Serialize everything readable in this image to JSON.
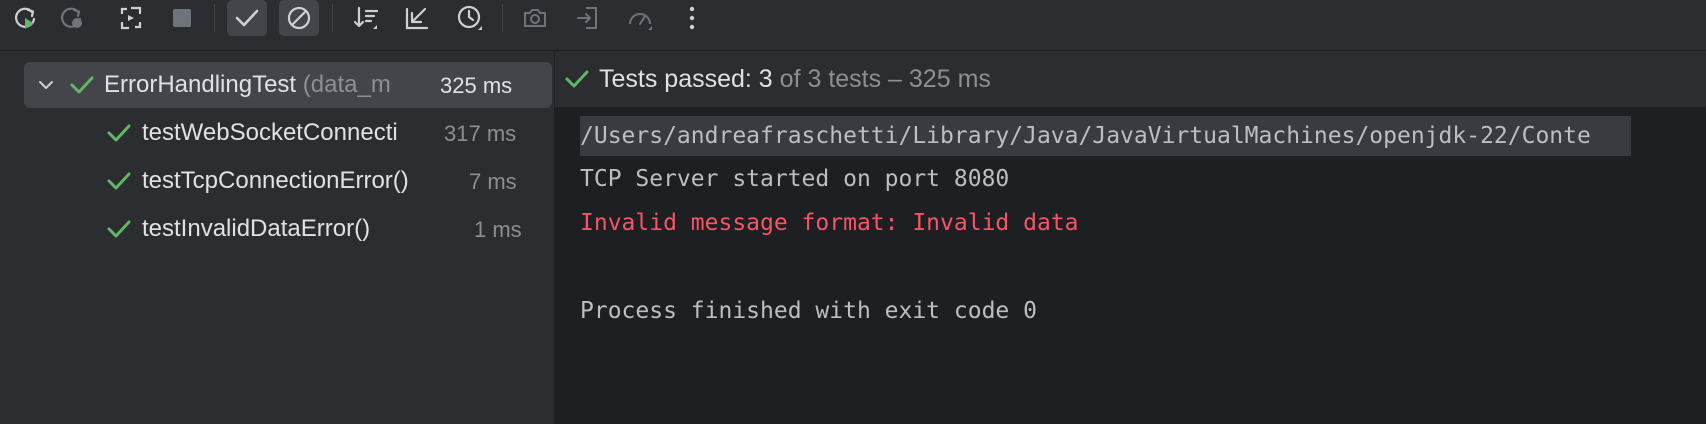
{
  "toolbar": {
    "buttons": [
      {
        "name": "rerun-icon",
        "label": "Rerun",
        "enabled": true
      },
      {
        "name": "rerun-failed-icon",
        "label": "Rerun Failed Tests",
        "enabled": false
      },
      {
        "name": "toggle-auto-test-icon",
        "label": "Toggle Auto-test",
        "enabled": true
      },
      {
        "name": "stop-icon",
        "label": "Stop",
        "enabled": false
      },
      {
        "name": "show-passed-icon",
        "label": "Show Passed",
        "active": true
      },
      {
        "name": "show-ignored-icon",
        "label": "Show Ignored",
        "active": true
      },
      {
        "name": "sort-icon",
        "label": "Sort",
        "enabled": true
      },
      {
        "name": "collapse-all-icon",
        "label": "Collapse All",
        "enabled": true
      },
      {
        "name": "test-history-icon",
        "label": "Test History",
        "enabled": true
      },
      {
        "name": "screenshot-icon",
        "label": "Screenshot",
        "enabled": false
      },
      {
        "name": "import-tests-icon",
        "label": "Import Tests",
        "enabled": false
      },
      {
        "name": "profiler-icon",
        "label": "Profiler",
        "enabled": false
      },
      {
        "name": "more-icon",
        "label": "More",
        "enabled": true
      }
    ]
  },
  "tree": {
    "root": {
      "name": "ErrorHandlingTest",
      "hint": "(data_m",
      "time": "325 ms",
      "status": "passed",
      "expanded": true
    },
    "children": [
      {
        "name": "testWebSocketConnecti",
        "time": "317 ms",
        "status": "passed"
      },
      {
        "name": "testTcpConnectionError()",
        "time": "7 ms",
        "status": "passed"
      },
      {
        "name": "testInvalidDataError()",
        "time": "1 ms",
        "status": "passed"
      }
    ]
  },
  "status": {
    "label": "Tests passed: 3",
    "detail": "of 3 tests – 325 ms"
  },
  "console": {
    "lines": [
      {
        "text": "/Users/andreafraschetti/Library/Java/JavaVirtualMachines/openjdk-22/Conte",
        "kind": "cmd"
      },
      {
        "text": "TCP Server started on port 8080",
        "kind": "out"
      },
      {
        "text": "Invalid message format: Invalid data",
        "kind": "err"
      },
      {
        "text": "",
        "kind": "out"
      },
      {
        "text": "Process finished with exit code 0",
        "kind": "out"
      }
    ]
  },
  "colors": {
    "background": "#2b2d30",
    "console_background": "#1e1f22",
    "selection": "#43454a",
    "pass_green": "#5fb865",
    "error_red": "#f75464",
    "text": "#dfe1e5",
    "text_dim": "#8c8f94"
  }
}
